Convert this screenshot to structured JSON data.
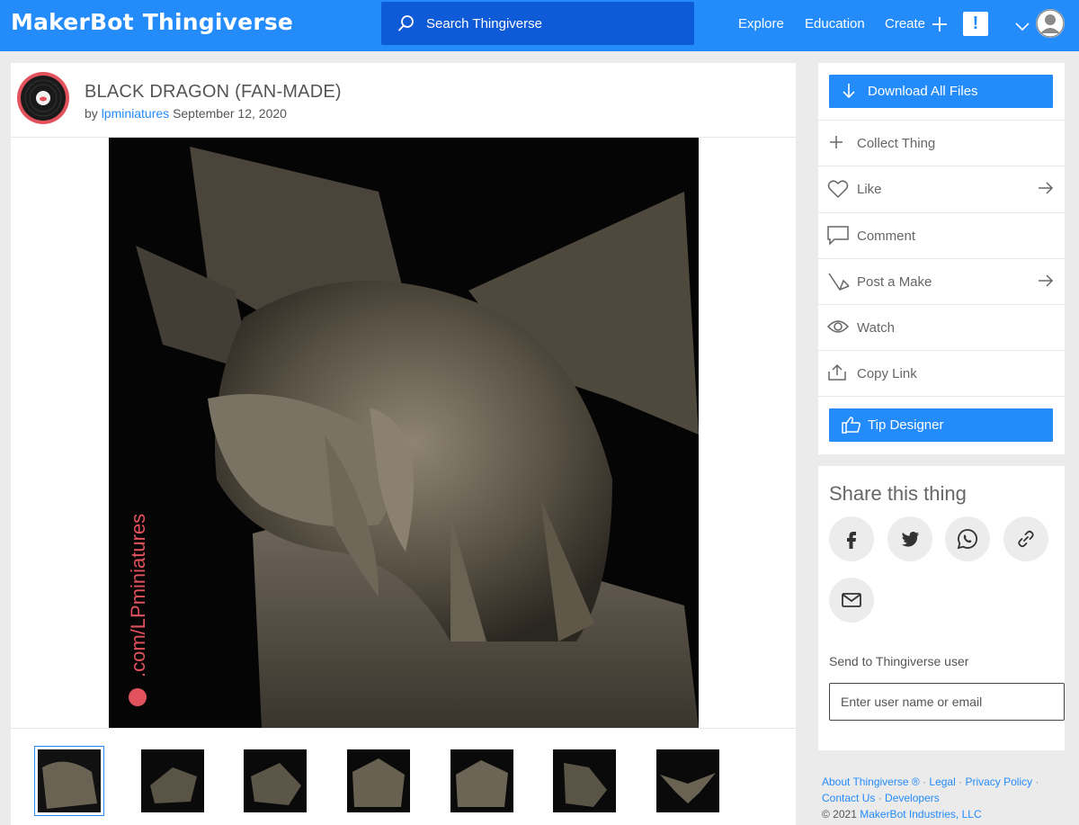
{
  "header": {
    "logo_part1": "MakerBot",
    "logo_part2": "Thingiverse",
    "search_placeholder": "Search Thingiverse",
    "nav": {
      "explore": "Explore",
      "education": "Education",
      "create": "Create"
    },
    "alert_label": "!"
  },
  "thing": {
    "title": "BLACK DRAGON (FAN-MADE)",
    "by_label": "by",
    "creator": "lpminiatures",
    "date": "September 12, 2020",
    "watermark": ".com/LPminiatures"
  },
  "gallery": {
    "thumbnails": 7,
    "active_index": 0
  },
  "actions": {
    "download": "Download All Files",
    "collect": "Collect Thing",
    "like": "Like",
    "comment": "Comment",
    "post_make": "Post a Make",
    "watch": "Watch",
    "copy_link": "Copy Link",
    "tip": "Tip Designer"
  },
  "share": {
    "title": "Share this thing",
    "buttons": [
      "facebook-icon",
      "twitter-icon",
      "whatsapp-icon",
      "link-icon",
      "email-icon"
    ],
    "send_label": "Send to Thingiverse user",
    "send_placeholder": "Enter user name or email"
  },
  "footer": {
    "about": "About Thingiverse",
    "legal": "Legal",
    "privacy": "Privacy Policy",
    "contact": "Contact Us",
    "developers": "Developers",
    "copyright": "© 2021",
    "company": "MakerBot Industries, LLC"
  },
  "colors": {
    "brand_blue": "#248bfb",
    "search_blue": "#0f5ad6",
    "avatar_red": "#e2525c"
  }
}
